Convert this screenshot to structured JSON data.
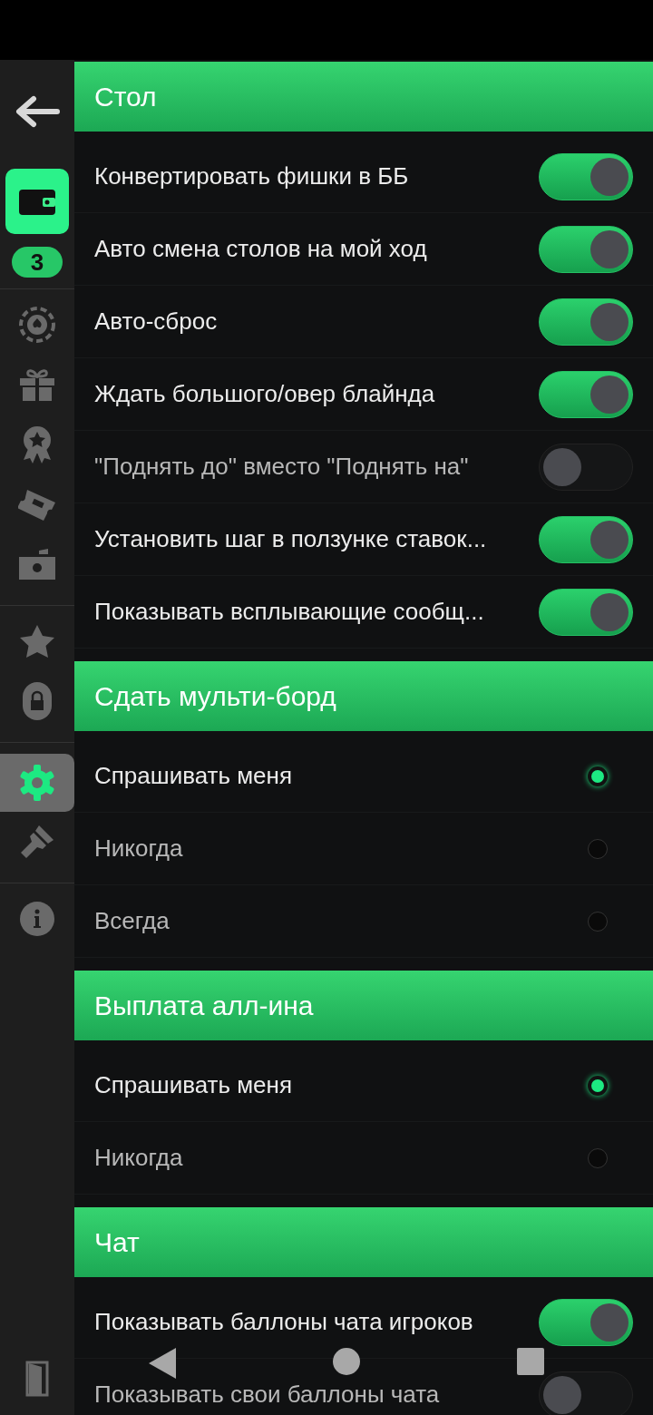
{
  "sidebar": {
    "wallet_badge": "3",
    "groups": [
      [
        {
          "kind": "chip",
          "selected": false
        },
        {
          "kind": "gift",
          "selected": false
        },
        {
          "kind": "medal",
          "selected": false
        },
        {
          "kind": "ticket",
          "selected": false
        },
        {
          "kind": "cash",
          "selected": false
        }
      ],
      [
        {
          "kind": "star",
          "selected": false
        },
        {
          "kind": "lock",
          "selected": false
        }
      ],
      [
        {
          "kind": "settings",
          "selected": true
        },
        {
          "kind": "brush",
          "selected": false
        }
      ],
      [
        {
          "kind": "info",
          "selected": false
        }
      ]
    ]
  },
  "sections": [
    {
      "title": "Стол",
      "rows": [
        {
          "kind": "toggle",
          "label": "Конвертировать фишки в ББ",
          "on": true
        },
        {
          "kind": "toggle",
          "label": "Авто смена столов на мой ход",
          "on": true
        },
        {
          "kind": "toggle",
          "label": "Авто-сброс",
          "on": true
        },
        {
          "kind": "toggle",
          "label": "Ждать большого/овер блайнда",
          "on": true
        },
        {
          "kind": "toggle",
          "label": "\"Поднять до\" вместо \"Поднять на\"",
          "on": false
        },
        {
          "kind": "toggle",
          "label": "Установить шаг в ползунке ставок...",
          "on": true
        },
        {
          "kind": "toggle",
          "label": "Показывать всплывающие сообщ...",
          "on": true
        }
      ]
    },
    {
      "title": "Сдать мульти-борд",
      "rows": [
        {
          "kind": "radio",
          "label": "Спрашивать меня",
          "selected": true
        },
        {
          "kind": "radio",
          "label": "Никогда",
          "selected": false
        },
        {
          "kind": "radio",
          "label": "Всегда",
          "selected": false
        }
      ]
    },
    {
      "title": "Выплата алл-ина",
      "rows": [
        {
          "kind": "radio",
          "label": "Спрашивать меня",
          "selected": true
        },
        {
          "kind": "radio",
          "label": "Никогда",
          "selected": false
        }
      ]
    },
    {
      "title": "Чат",
      "rows": [
        {
          "kind": "toggle",
          "label": "Показывать баллоны чата игроков",
          "on": true
        },
        {
          "kind": "toggle",
          "label": "Показывать свои баллоны чата",
          "on": false
        }
      ]
    }
  ]
}
